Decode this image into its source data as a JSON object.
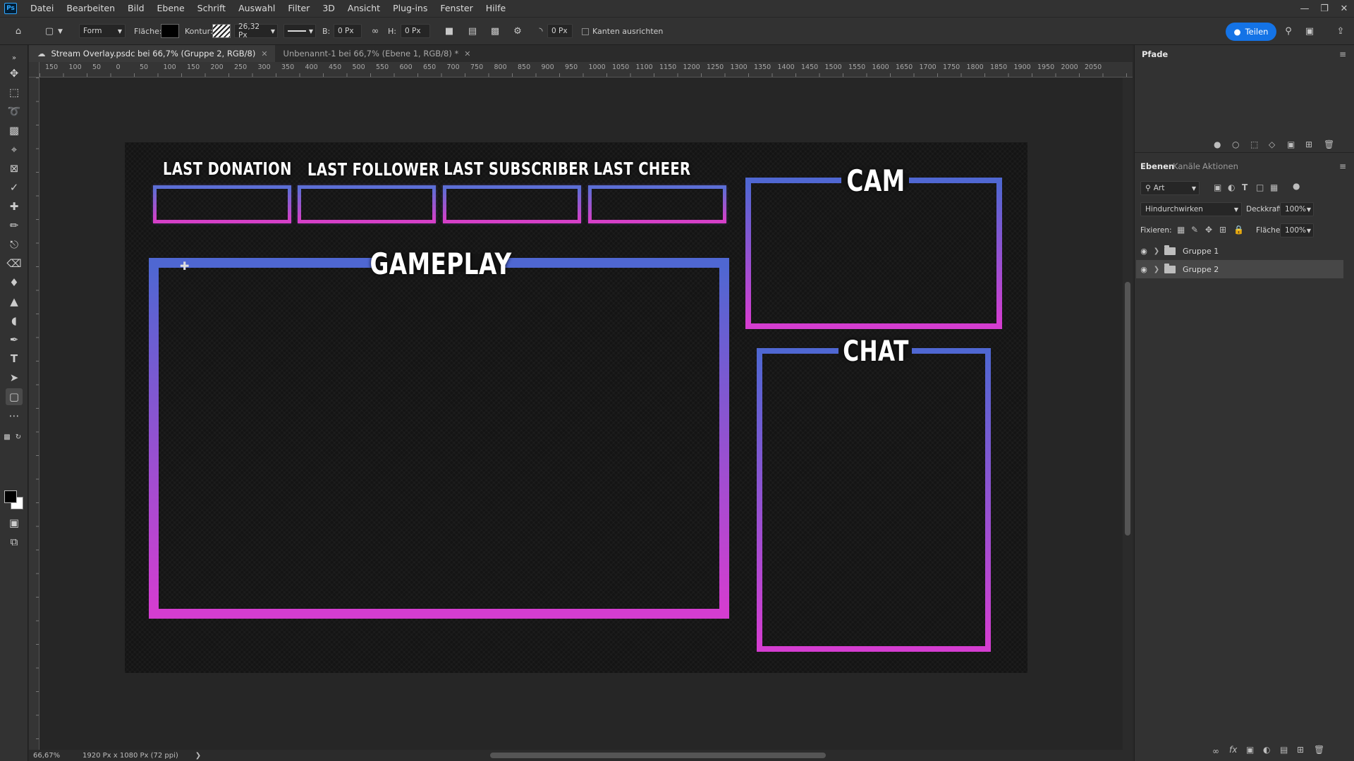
{
  "menubar": {
    "items": [
      "Datei",
      "Bearbeiten",
      "Bild",
      "Ebene",
      "Schrift",
      "Auswahl",
      "Filter",
      "3D",
      "Ansicht",
      "Plug-ins",
      "Fenster",
      "Hilfe"
    ]
  },
  "options": {
    "mode": "Form",
    "fill_label": "Fläche:",
    "stroke_label": "Kontur:",
    "stroke_size": "26,32 Px",
    "width_label": "B:",
    "width_value": "0 Px",
    "height_label": "H:",
    "height_value": "0 Px",
    "radius_value": "0 Px",
    "align_edges": "Kanten ausrichten",
    "share": "Teilen"
  },
  "tabs": [
    {
      "label": "Stream Overlay.psdc bei 66,7% (Gruppe 2, RGB/8)"
    },
    {
      "label": "Unbenannt-1 bei 66,7% (Ebene 1, RGB/8) *"
    }
  ],
  "ruler": {
    "h_ticks": [
      "150",
      "100",
      "50",
      "0",
      "50",
      "100",
      "150",
      "200",
      "250",
      "300",
      "350",
      "400",
      "450",
      "500",
      "550",
      "600",
      "650",
      "700",
      "750",
      "800",
      "850",
      "900",
      "950",
      "1000",
      "1050",
      "1100",
      "1150",
      "1200",
      "1250",
      "1300",
      "1350",
      "1400",
      "1450",
      "1500",
      "1550",
      "1600",
      "1650",
      "1700",
      "1750",
      "1800",
      "1850",
      "1900",
      "1950",
      "2000",
      "2050"
    ]
  },
  "canvas": {
    "labels": {
      "last_donation": "LAST DONATION",
      "last_follower": "LAST FOLLOWER",
      "last_subscriber": "LAST SUBSCRIBER",
      "last_cheer": "LAST CHEER",
      "gameplay": "GAMEPLAY",
      "cam": "CAM",
      "chat": "CHAT"
    },
    "gradient_top": "#4f67d2",
    "gradient_bottom": "#d43dd0"
  },
  "status": {
    "zoom": "66,67%",
    "doc_size": "1920 Px x 1080 Px (72 ppi)"
  },
  "panels": {
    "paths_tab": "Pfade",
    "layers_tabs": [
      "Ebenen",
      "Kanäle",
      "Aktionen"
    ],
    "filter_kind": "Art",
    "blend_mode": "Hindurchwirken",
    "opacity_label": "Deckkraft:",
    "opacity_value": "100%",
    "lock_label": "Fixieren:",
    "fill_label": "Fläche:",
    "fill_value": "100%",
    "layers": [
      {
        "name": "Gruppe 1",
        "selected": false
      },
      {
        "name": "Gruppe 2",
        "selected": true
      }
    ]
  },
  "colors": {
    "accent": "#1473e6",
    "panel_bg": "#323232",
    "workspace_bg": "#262626"
  }
}
